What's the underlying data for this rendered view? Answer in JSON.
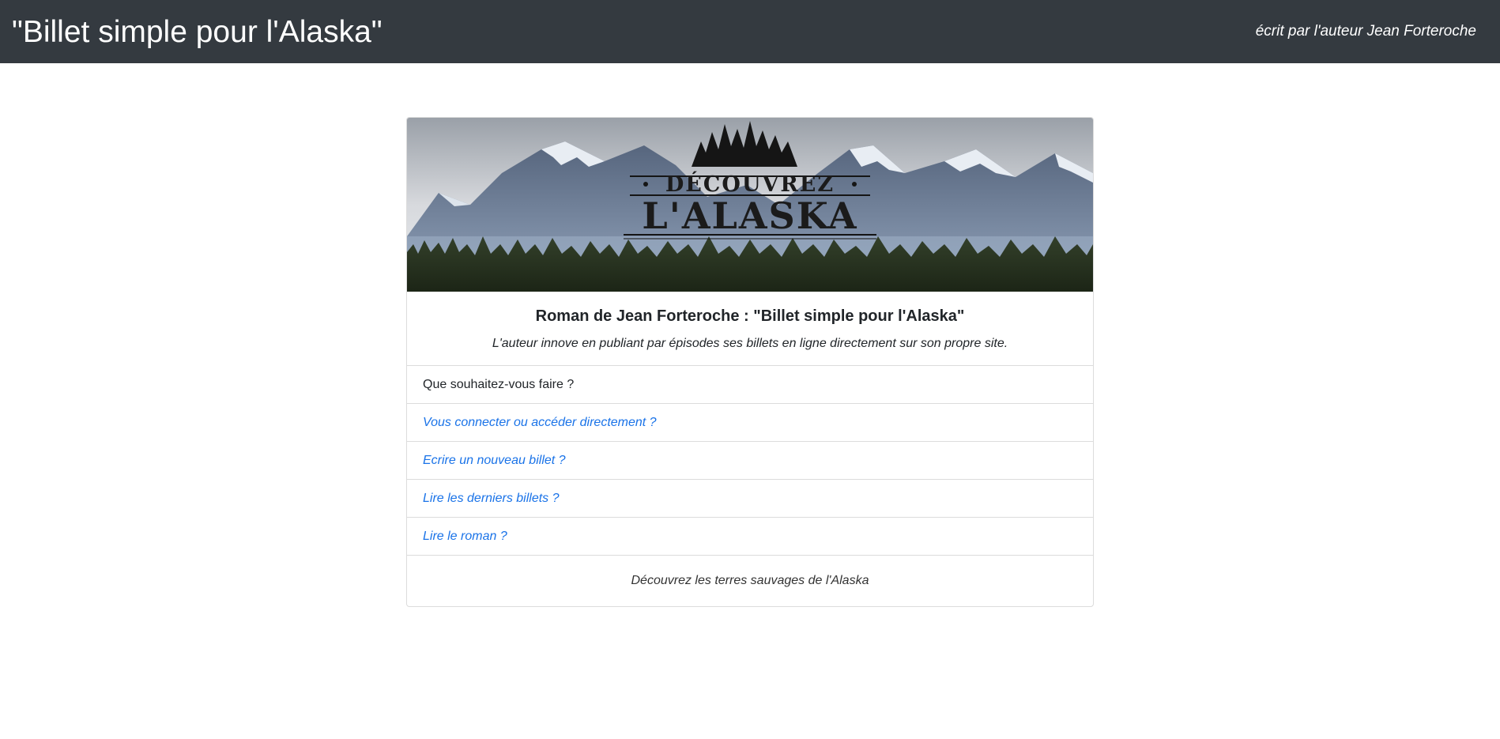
{
  "header": {
    "title": "\"Billet simple pour l'Alaska\"",
    "byline": "écrit par l'auteur Jean Forteroche"
  },
  "banner": {
    "line1": "DÉCOUVREZ",
    "line2": "L'ALASKA",
    "colors": {
      "sky": "#c9ccd2",
      "mountains": "#6f7f99",
      "snow": "#e8edf3",
      "forest": "#28331f"
    }
  },
  "card": {
    "title": "Roman de Jean Forteroche : \"Billet simple pour l'Alaska\"",
    "subtitle": "L'auteur innove en publiant par épisodes ses billets en ligne directement sur son propre site.",
    "question": "Que souhaitez-vous faire ?",
    "links": [
      "Vous connecter ou accéder directement ?",
      "Ecrire un nouveau billet ?",
      "Lire les derniers billets ?",
      "Lire le roman ?"
    ],
    "footer": "Découvrez les terres sauvages de l'Alaska"
  },
  "theme": {
    "navbar": "#343a40",
    "link": "#1a73e8"
  }
}
